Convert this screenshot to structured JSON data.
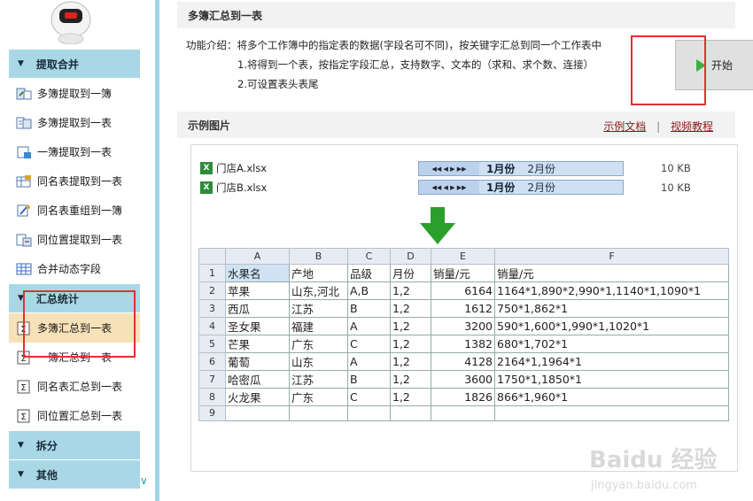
{
  "sidebar": {
    "sections": [
      {
        "label": "提取合并"
      },
      {
        "label": "汇总统计"
      },
      {
        "label": "拆分"
      },
      {
        "label": "其他"
      }
    ],
    "extract_items": [
      {
        "label": "多簿提取到一簿"
      },
      {
        "label": "多簿提取到一表"
      },
      {
        "label": "一簿提取到一表"
      },
      {
        "label": "同名表提取到一表"
      },
      {
        "label": "同名表重组到一簿"
      },
      {
        "label": "同位置提取到一表"
      },
      {
        "label": "合并动态字段"
      }
    ],
    "summary_items": [
      {
        "label": "多簿汇总到一表"
      },
      {
        "label": "一簿汇总到一表"
      },
      {
        "label": "同名表汇总到一表"
      },
      {
        "label": "同位置汇总到一表"
      }
    ]
  },
  "main": {
    "title": "多簿汇总到一表",
    "intro_line1": "功能介绍：将多个工作簿中的指定表的数据(字段名可不同)，按关键字汇总到同一个工作表中",
    "intro_line2": "1.将得到一个表，按指定字段汇总，支持数字、文本的（求和、求个数、连接）",
    "intro_line3": "2.可设置表头表尾",
    "start_label": "开始",
    "example_title": "示例图片",
    "link_doc": "示例文档",
    "link_video": "视频教程",
    "link_sep": "|"
  },
  "example": {
    "files": [
      {
        "name": "门店A.xlsx",
        "tab1": "1月份",
        "tab2": "2月份",
        "size": "10 KB"
      },
      {
        "name": "门店B.xlsx",
        "tab1": "1月份",
        "tab2": "2月份",
        "size": "10 KB"
      }
    ],
    "columns": [
      "A",
      "B",
      "C",
      "D",
      "E",
      "F"
    ],
    "rows": [
      {
        "n": "1",
        "a": "水果名",
        "b": "产地",
        "c": "品级",
        "d": "月份",
        "e": "销量/元",
        "f": "销量/元"
      },
      {
        "n": "2",
        "a": "苹果",
        "b": "山东,河北",
        "c": "A,B",
        "d": "1,2",
        "e": "6164",
        "f": "1164*1,890*2,990*1,1140*1,1090*1"
      },
      {
        "n": "3",
        "a": "西瓜",
        "b": "江苏",
        "c": "B",
        "d": "1,2",
        "e": "1612",
        "f": "750*1,862*1"
      },
      {
        "n": "4",
        "a": "圣女果",
        "b": "福建",
        "c": "A",
        "d": "1,2",
        "e": "3200",
        "f": "590*1,600*1,990*1,1020*1"
      },
      {
        "n": "5",
        "a": "芒果",
        "b": "广东",
        "c": "C",
        "d": "1,2",
        "e": "1382",
        "f": "680*1,702*1"
      },
      {
        "n": "6",
        "a": "葡萄",
        "b": "山东",
        "c": "A",
        "d": "1,2",
        "e": "4128",
        "f": "2164*1,1964*1"
      },
      {
        "n": "7",
        "a": "哈密瓜",
        "b": "江苏",
        "c": "B",
        "d": "1,2",
        "e": "3600",
        "f": "1750*1,1850*1"
      },
      {
        "n": "8",
        "a": "火龙果",
        "b": "广东",
        "c": "C",
        "d": "1,2",
        "e": "1826",
        "f": "866*1,960*1"
      },
      {
        "n": "9",
        "a": "",
        "b": "",
        "c": "",
        "d": "",
        "e": "",
        "f": ""
      }
    ]
  },
  "watermark": {
    "text": "Baidu 经验",
    "url_text": "jingyan.baidu.com"
  },
  "colors": {
    "accent": "#a8d8e5",
    "active": "#f7e1b8",
    "annotation": "#e53030",
    "arrow": "#2aa02a"
  }
}
